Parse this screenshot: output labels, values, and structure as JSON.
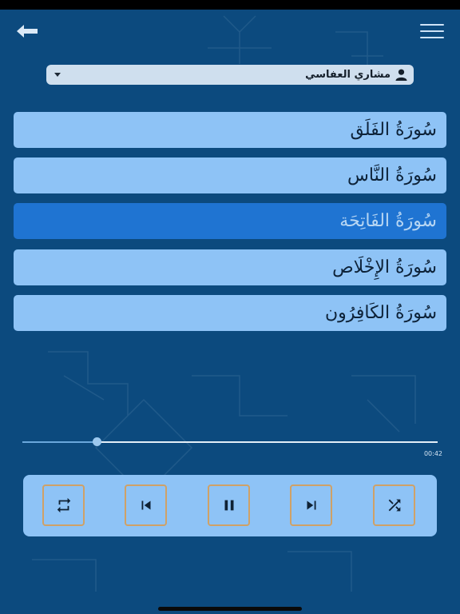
{
  "reciter": {
    "name": "مشاري العفاسي",
    "icon": "user-icon"
  },
  "surahs": [
    {
      "name": "سُورَةُ الفَلَق"
    },
    {
      "name": "سُورَةُ النَّاس"
    },
    {
      "name": "سُورَةُ الفَاتِحَة"
    },
    {
      "name": "سُورَةُ الإِخْلَاص"
    },
    {
      "name": "سُورَةُ الكَافِرُون"
    }
  ],
  "active_surah_index": 2,
  "player": {
    "elapsed": "00:42",
    "progress_fraction": 0.18,
    "controls": [
      "repeat-icon",
      "previous-icon",
      "pause-icon",
      "next-icon",
      "shuffle-icon"
    ]
  },
  "colors": {
    "background": "#0c4a7e",
    "item": "#8ec3f6",
    "item_active": "#1f74d2",
    "button_border": "#cfa167"
  }
}
